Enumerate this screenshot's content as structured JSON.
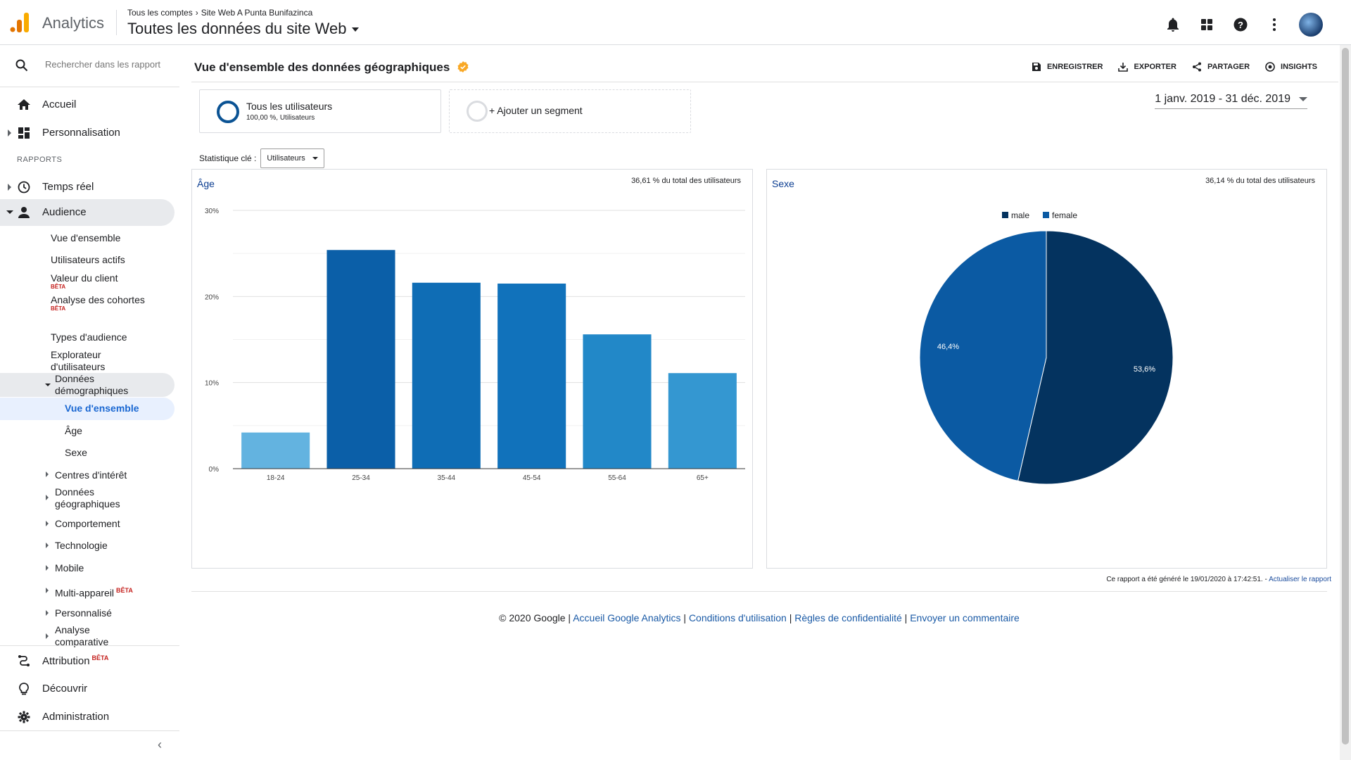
{
  "header": {
    "app_name": "Analytics",
    "breadcrumb": [
      "Tous les comptes",
      "Site Web A Punta Bunifazinca"
    ],
    "property": "Toutes les données du site Web",
    "icons": [
      "bell-icon",
      "apps-grid-icon",
      "help-icon",
      "more-vert-icon",
      "avatar"
    ]
  },
  "sidebar": {
    "search_placeholder": "Rechercher dans les rapport",
    "home": "Accueil",
    "customization": "Personnalisation",
    "reports_label": "RAPPORTS",
    "realtime": "Temps réel",
    "audience": "Audience",
    "audience_items": {
      "overview": "Vue d'ensemble",
      "active_users": "Utilisateurs actifs",
      "lifetime_value": "Valeur du client",
      "cohort": "Analyse des cohortes",
      "audiences": "Types d'audience",
      "user_explorer": "Explorateur d'utilisateurs",
      "demographics": "Données démographiques",
      "demo_overview": "Vue d'ensemble",
      "demo_age": "Âge",
      "demo_gender": "Sexe",
      "interests": "Centres d'intérêt",
      "geo": "Données géographiques",
      "behavior": "Comportement",
      "technology": "Technologie",
      "mobile": "Mobile",
      "cross_device": "Multi-appareil",
      "custom": "Personnalisé",
      "benchmarking": "Analyse comparative"
    },
    "beta": "BÊTA",
    "attribution": "Attribution",
    "discover": "Découvrir",
    "admin": "Administration"
  },
  "main": {
    "title": "Vue d'ensemble des données géographiques",
    "actions": [
      "ENREGISTRER",
      "EXPORTER",
      "PARTAGER",
      "INSIGHTS"
    ],
    "segment_title": "Tous les utilisateurs",
    "segment_sub": "100,00 %, Utilisateurs",
    "add_segment": "+ Ajouter un segment",
    "date_range": "1 janv. 2019 - 31 déc. 2019",
    "key_stat_label": "Statistique clé :",
    "key_stat_value": "Utilisateurs",
    "age_card": {
      "title": "Âge",
      "note": "36,61 % du total des utilisateurs"
    },
    "gender_card": {
      "title": "Sexe",
      "note": "36,14 % du total des utilisateurs"
    },
    "report_generated": "Ce rapport a été généré le 19/01/2020 à 17:42:51. -",
    "refresh_link": "Actualiser le rapport",
    "footer": {
      "copyright": "© 2020 Google",
      "links": [
        "Accueil Google Analytics",
        "Conditions d'utilisation",
        "Règles de confidentialité",
        "Envoyer un commentaire"
      ]
    }
  },
  "chart_data": [
    {
      "type": "bar",
      "categories": [
        "18-24",
        "25-34",
        "35-44",
        "45-54",
        "55-64",
        "65+"
      ],
      "values": [
        4.2,
        25.4,
        21.6,
        21.5,
        15.6,
        11.1
      ],
      "ylim": [
        0,
        30
      ],
      "yticks": [
        "0%",
        "10%",
        "20%",
        "30%"
      ],
      "colors": [
        "#63b3e0",
        "#0b5fa8",
        "#0f6db5",
        "#1172bb",
        "#2288c8",
        "#3497d1"
      ],
      "grid": true
    },
    {
      "type": "pie",
      "labels": [
        "male",
        "female"
      ],
      "values": [
        53.6,
        46.4
      ],
      "value_labels": [
        "53,6%",
        "46,4%"
      ],
      "colors": [
        "#04335f",
        "#0b5aa3"
      ],
      "legend": "top"
    }
  ]
}
